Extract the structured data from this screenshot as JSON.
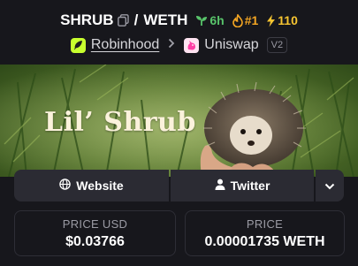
{
  "header": {
    "base_symbol": "SHRUB",
    "separator": "/",
    "quote_symbol": "WETH",
    "age": "6h",
    "rank": "#1",
    "boosts": "110",
    "chain": "Robinhood",
    "dex": "Uniswap",
    "dex_version": "V2",
    "icons": {
      "copy": "copy-icon",
      "age": "seedling-icon",
      "rank": "flame-icon",
      "boost": "lightning-icon",
      "chain": "feather-icon",
      "dex": "unicorn-icon",
      "separator": "chevron-right-icon"
    }
  },
  "banner": {
    "title": "Lil’ Shrub"
  },
  "links": {
    "website_label": "Website",
    "twitter_label": "Twitter",
    "icons": {
      "website": "globe-icon",
      "twitter": "user-icon",
      "more": "chevron-down-icon"
    }
  },
  "stats": {
    "price_usd_label": "PRICE USD",
    "price_usd_value": "$0.03766",
    "price_native_label": "PRICE",
    "price_native_value": "0.00001735 WETH"
  },
  "colors": {
    "background": "#17171c",
    "button_bg": "#2b2b33",
    "age_green": "#58c36a",
    "rank_orange": "#f5a623",
    "boost_yellow": "#f7c531",
    "chain_badge": "#c8ff2e"
  }
}
